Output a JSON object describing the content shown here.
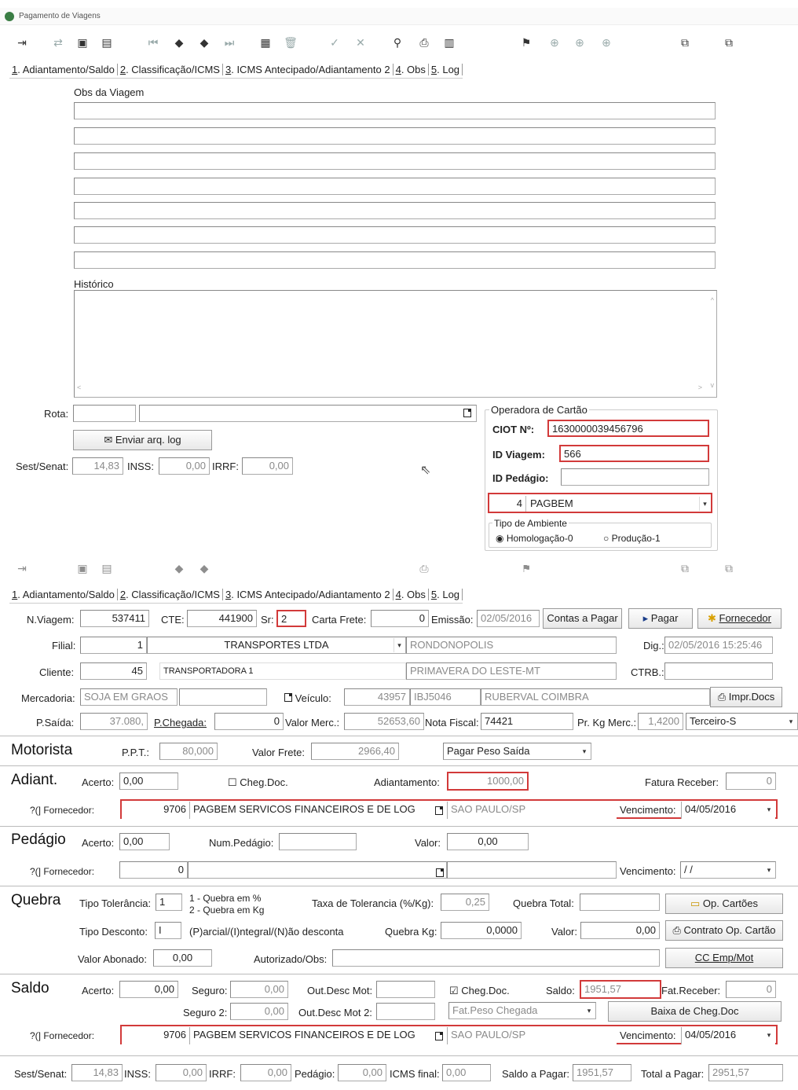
{
  "window": {
    "title": "Pagamento de Viagens"
  },
  "tabs": [
    {
      "num": "1",
      "rest": ". Adiantamento/Saldo"
    },
    {
      "num": "2",
      "rest": ". Classificação/ICMS"
    },
    {
      "num": "3",
      "rest": ". ICMS Antecipado/Adiantamento 2"
    },
    {
      "num": "4",
      "rest": ". Obs"
    },
    {
      "num": "5",
      "rest": ". Log"
    }
  ],
  "obs": {
    "obs_label": "Obs da Viagem",
    "historico_label": "Histórico",
    "rota_label": "Rota:",
    "enviar_label": "Enviar arq. log",
    "sest_label": "Sest/Senat:",
    "sest_value": "14,83",
    "inss_label": "INSS:",
    "inss_value": "0,00",
    "irrf_label": "IRRF:",
    "irrf_value": "0,00"
  },
  "operadora": {
    "legend": "Operadora de Cartão",
    "ciot_label": "CIOT Nº:",
    "ciot_value": "1630000039456796",
    "idviagem_label": "ID Viagem:",
    "idviagem_value": "566",
    "idpedagio_label": "ID Pedágio:",
    "idpedagio_value": "",
    "code": "4",
    "name": "PAGBEM",
    "ambiente_legend": "Tipo de Ambiente",
    "homolog": "Homologação-0",
    "producao": "Produção-1"
  },
  "header": {
    "nviagem_label": "N.Viagem:",
    "nviagem": "537411",
    "cte_label": "CTE:",
    "cte": "441900",
    "sr_label": "Sr:",
    "sr": "2",
    "carta_label": "Carta Frete:",
    "carta": "0",
    "emissao_label": "Emissão:",
    "emissao": "02/05/2016",
    "contas_btn": "Contas a Pagar",
    "pagar_btn": "Pagar",
    "fornecedor_btn": "Fornecedor",
    "filial_label": "Filial:",
    "filial_code": "1",
    "filial_name": "TRANSPORTES LTDA",
    "filial_city": "RONDONOPOLIS",
    "dig_label": "Dig.:",
    "dig": "02/05/2016 15:25:46",
    "cliente_label": "Cliente:",
    "cliente_code": "45",
    "cliente_name": "TRANSPORTADORA 1",
    "cliente_city": "PRIMAVERA DO LESTE-MT",
    "ctrb_label": "CTRB.:",
    "ctrb": "",
    "merc_label": "Mercadoria:",
    "merc": "SOJA EM GRAOS",
    "veiculo_label": "Veículo:",
    "veiculo_code": "43957",
    "placa": "IBJ5046",
    "motorista_nome": "RUBERVAL COIMBRA",
    "impr_btn": "Impr.Docs",
    "psaida_label": "P.Saída:",
    "psaida": "37.080,",
    "pcheg_label": "P.Chegada:",
    "pcheg": "0",
    "valormerc_label": "Valor Merc.:",
    "valormerc": "52653,60",
    "nf_label": "Nota Fiscal:",
    "nf": "74421",
    "prkg_label": "Pr. Kg Merc.:",
    "prkg": "1,4200",
    "terceiro": "Terceiro-S"
  },
  "motorista": {
    "title": "Motorista",
    "ppt_label": "P.P.T.:",
    "ppt": "80,000",
    "frete_label": "Valor Frete:",
    "frete": "2966,40",
    "pagar_select": "Pagar Peso Saída"
  },
  "adiant": {
    "title": "Adiant.",
    "acerto_label": "Acerto:",
    "acerto": "0,00",
    "cheg_label": "Cheg.Doc.",
    "adiant_label": "Adiantamento:",
    "adiant": "1000,00",
    "fatura_label": "Fatura Receber:",
    "fatura": "0",
    "forn_label": "?(] Fornecedor:",
    "forn_code": "9706",
    "forn_name": "PAGBEM SERVICOS FINANCEIROS E DE LOG",
    "forn_city": "SAO PAULO/SP",
    "venc_label": "Vencimento:",
    "venc": "04/05/2016"
  },
  "pedagio": {
    "title": "Pedágio",
    "acerto_label": "Acerto:",
    "acerto": "0,00",
    "num_label": "Num.Pedágio:",
    "num": "",
    "valor_label": "Valor:",
    "valor": "0,00",
    "forn_label": "?(] Fornecedor:",
    "forn_code": "0",
    "venc_label": "Vencimento:",
    "venc": "/ /"
  },
  "quebra": {
    "title": "Quebra",
    "tipotol_label": "Tipo Tolerância:",
    "tipotol": "1",
    "opt1": "1 - Quebra em %",
    "opt2": "2 - Quebra em Kg",
    "taxa_label": "Taxa de Tolerancia (%/Kg):",
    "taxa": "0,25",
    "total_label": "Quebra Total:",
    "total": "",
    "opcartoes_btn": "Op. Cartões",
    "tipodesc_label": "Tipo Desconto:",
    "tipodesc": "I",
    "desc_opts": "(P)arcial/(I)ntegral/(N)ão desconta",
    "kg_label": "Quebra Kg:",
    "kg": "0,0000",
    "valor_label": "Valor:",
    "valor": "0,00",
    "contrato_btn": "Contrato Op. Cartão",
    "abon_label": "Valor Abonado:",
    "abon": "0,00",
    "autoriz_label": "Autorizado/Obs:",
    "ccemp_btn": "CC Emp/Mot"
  },
  "saldo": {
    "title": "Saldo",
    "acerto_label": "Acerto:",
    "acerto": "0,00",
    "seguro_label": "Seguro:",
    "seguro": "0,00",
    "outdesc_label": "Out.Desc Mot:",
    "cheg_label": "Cheg.Doc.",
    "saldo_label": "Saldo:",
    "saldo": "1951,57",
    "fatrec_label": "Fat.Receber:",
    "fatrec": "0",
    "seguro2_label": "Seguro 2:",
    "seguro2": "0,00",
    "outdesc2_label": "Out.Desc Mot 2:",
    "fatpeso": "Fat.Peso Chegada",
    "baixa_btn": "Baixa de Cheg.Doc",
    "forn_label": "?(] Fornecedor:",
    "forn_code": "9706",
    "forn_name": "PAGBEM SERVICOS FINANCEIROS E DE LOG",
    "forn_city": "SAO PAULO/SP",
    "venc_label": "Vencimento:",
    "venc": "04/05/2016"
  },
  "footer": {
    "sest_label": "Sest/Senat:",
    "sest": "14,83",
    "inss_label": "INSS:",
    "inss": "0,00",
    "irrf_label": "IRRF:",
    "irrf": "0,00",
    "ped_label": "Pedágio:",
    "ped": "0,00",
    "icms_label": "ICMS final:",
    "icms": "0,00",
    "saldopagar_label": "Saldo a Pagar:",
    "saldopagar": "1951,57",
    "totalpagar_label": "Total a Pagar:",
    "totalpagar": "2951,57"
  }
}
